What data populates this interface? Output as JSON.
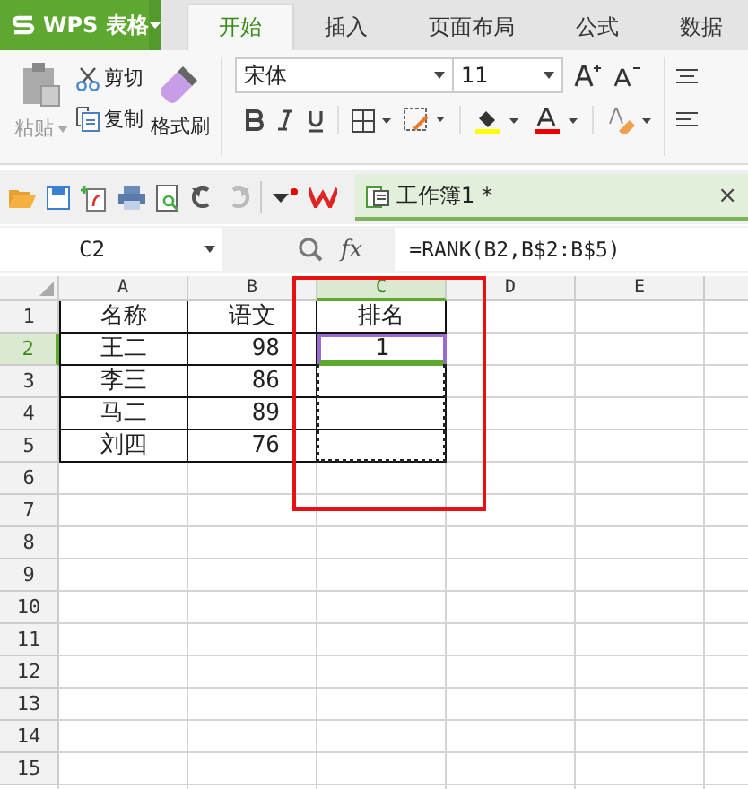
{
  "app_menu": {
    "label": "WPS 表格"
  },
  "tabs": [
    {
      "label": "开始",
      "selected": true
    },
    {
      "label": "插入",
      "selected": false
    },
    {
      "label": "页面布局",
      "selected": false
    },
    {
      "label": "公式",
      "selected": false
    },
    {
      "label": "数据",
      "selected": false
    }
  ],
  "clipboard": {
    "paste": "粘贴",
    "cut": "剪切",
    "copy": "复制",
    "format_painter": "格式刷"
  },
  "font": {
    "family": "宋体",
    "size": "11"
  },
  "document_tab": {
    "title": "工作簿1 *",
    "close": "×"
  },
  "name_box": {
    "value": "C2"
  },
  "formula_bar": {
    "fx": "fx",
    "value": "=RANK(B2,B$2:B$5)"
  },
  "columns": [
    {
      "label": "A",
      "selected": false
    },
    {
      "label": "B",
      "selected": false
    },
    {
      "label": "C",
      "selected": true
    },
    {
      "label": "D",
      "selected": false
    },
    {
      "label": "E",
      "selected": false
    }
  ],
  "copy_marquee": true,
  "rows": [
    {
      "number": "1",
      "selected": false,
      "cells": [
        {
          "text": "名称"
        },
        {
          "text": "语文"
        },
        {
          "text": "排名",
          "active": false
        }
      ]
    },
    {
      "number": "2",
      "selected": true,
      "cells": [
        {
          "text": "王二"
        },
        {
          "text": "98"
        },
        {
          "text": "1",
          "active": true
        }
      ]
    },
    {
      "number": "3",
      "selected": false,
      "cells": [
        {
          "text": "李三"
        },
        {
          "text": "86"
        }
      ]
    },
    {
      "number": "4",
      "selected": false,
      "cells": [
        {
          "text": "马二"
        },
        {
          "text": "89"
        }
      ]
    },
    {
      "number": "5",
      "selected": false,
      "cells": [
        {
          "text": "刘四"
        },
        {
          "text": "76"
        }
      ]
    },
    {
      "number": "6",
      "selected": false
    },
    {
      "number": "7",
      "selected": false
    },
    {
      "number": "8",
      "selected": false
    },
    {
      "number": "9",
      "selected": false
    },
    {
      "number": "10",
      "selected": false
    },
    {
      "number": "11",
      "selected": false
    },
    {
      "number": "12",
      "selected": false
    },
    {
      "number": "13",
      "selected": false
    },
    {
      "number": "14",
      "selected": false
    },
    {
      "number": "15",
      "selected": false
    }
  ]
}
